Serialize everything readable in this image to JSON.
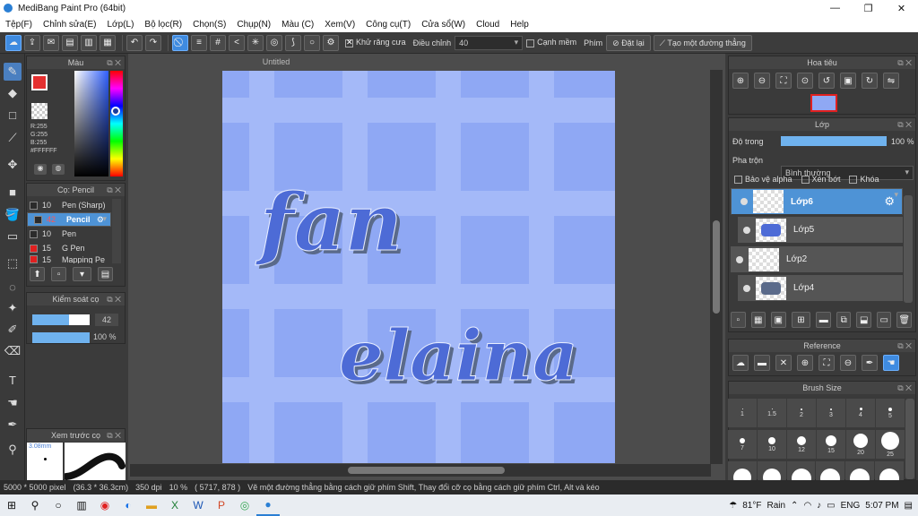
{
  "window": {
    "title": "MediBang Paint Pro (64bit)",
    "controls": [
      "—",
      "❐",
      "✕"
    ]
  },
  "menu": [
    "Tệp(F)",
    "Chỉnh sửa(E)",
    "Lớp(L)",
    "Bộ lọc(R)",
    "Chọn(S)",
    "Chụp(N)",
    "Màu (C)",
    "Xem(V)",
    "Công cụ(T)",
    "Cửa sổ(W)",
    "Cloud",
    "Help"
  ],
  "toolbar": {
    "antialias_label": "Khử răng cưa",
    "adjust_label": "Điều chỉnh",
    "adjust_value": "40",
    "smooth_edge_label": "Cạnh mềm",
    "key_label": "Phím",
    "reset_label": "Đặt lại",
    "straight_line_label": "Tạo một đường thẳng"
  },
  "color_panel": {
    "title": "Màu",
    "r": "R:255",
    "g": "G:255",
    "b": "B:255",
    "hex": "#FFFFFF"
  },
  "brush_panel": {
    "title": "Cọ: Pencil",
    "items": [
      {
        "size": "10",
        "name": "Pen (Sharp)",
        "color": "#2b2b2b"
      },
      {
        "size": "42",
        "name": "Pencil",
        "color": "#2b2b2b"
      },
      {
        "size": "10",
        "name": "Pen",
        "color": "#2b2b2b"
      },
      {
        "size": "15",
        "name": "G Pen",
        "color": "#e02020"
      },
      {
        "size": "15",
        "name": "Mapping Pe",
        "color": "#e02020"
      }
    ]
  },
  "brush_control": {
    "title": "Kiểm soát cọ",
    "size": "42",
    "opacity": "100 %"
  },
  "preview": {
    "title": "Xem trước cọ",
    "size": "3.08mm"
  },
  "document": {
    "tab": "Untitled",
    "text_line1": "fan",
    "text_line2": "elaina"
  },
  "navigator": {
    "title": "Hoa tiêu"
  },
  "layer_panel": {
    "title": "Lớp",
    "opacity_label": "Độ trong",
    "opacity_value": "100 %",
    "blend_label": "Pha trộn",
    "blend_value": "Bình thường",
    "protect_alpha": "Bảo vệ alpha",
    "clipping": "Xén bớt",
    "lock": "Khóa",
    "layers": [
      {
        "name": "Lớp6",
        "selected": true
      },
      {
        "name": "Lớp5",
        "selected": false
      },
      {
        "name": "Lớp2",
        "selected": false
      },
      {
        "name": "Lớp4",
        "selected": false
      }
    ]
  },
  "reference": {
    "title": "Reference"
  },
  "brush_size": {
    "title": "Brush Size",
    "sizes": [
      "1",
      "1.5",
      "2",
      "3",
      "4",
      "5",
      "7",
      "10",
      "12",
      "15",
      "20",
      "25"
    ]
  },
  "status": {
    "size": "5000 * 5000 pixel",
    "dims": "(36.3 * 36.3cm)",
    "dpi": "350 dpi",
    "zoom": "10 %",
    "coords": "( 5717, 878 )",
    "hint": "Vẽ một đường thẳng bằng cách giữ phím Shift, Thay đổi cỡ cọ bằng cách giữ phím Ctrl, Alt và kéo"
  },
  "taskbar": {
    "weather_temp": "81°F",
    "weather_text": "Rain",
    "lang": "ENG",
    "time": "5:07 PM"
  }
}
